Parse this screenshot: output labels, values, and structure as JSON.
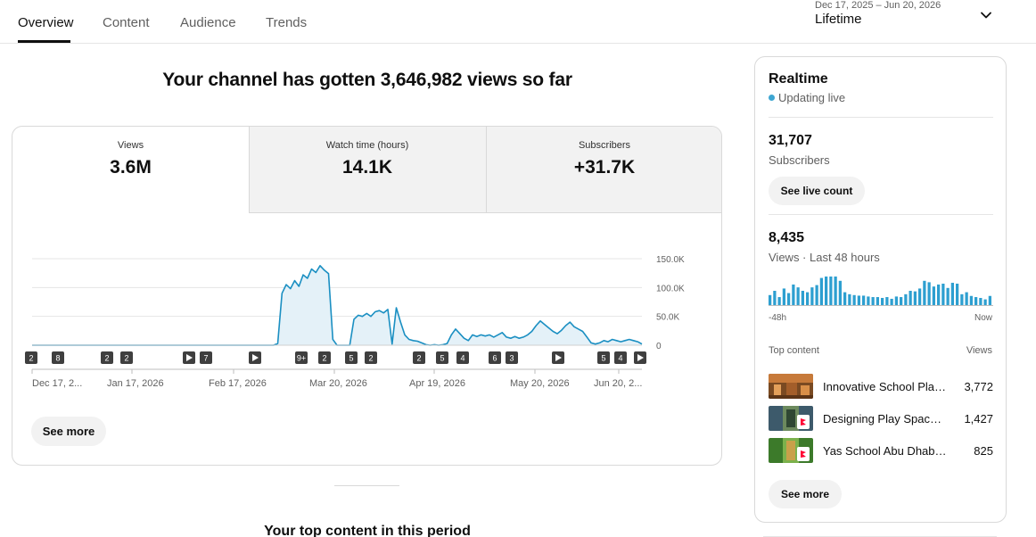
{
  "tabs": [
    {
      "label": "Overview",
      "active": true
    },
    {
      "label": "Content",
      "active": false
    },
    {
      "label": "Audience",
      "active": false
    },
    {
      "label": "Trends",
      "active": false
    }
  ],
  "date_filter": {
    "range": "Dec 17, 2025 – Jun 20, 2026",
    "label": "Lifetime",
    "icon": "chevron-down-icon"
  },
  "headline": "Your channel has gotten 3,646,982 views so far",
  "metrics": [
    {
      "label": "Views",
      "value": "3.6M"
    },
    {
      "label": "Watch time (hours)",
      "value": "14.1K"
    },
    {
      "label": "Subscribers",
      "value": "+31.7K"
    }
  ],
  "chart_data": {
    "type": "area",
    "series": [
      {
        "values": [
          0,
          0,
          0,
          0,
          0,
          0,
          0,
          0,
          0,
          0,
          0,
          0,
          0,
          0,
          0,
          0,
          0,
          0,
          0,
          0,
          0,
          0,
          0,
          0,
          0,
          0,
          0,
          0,
          0,
          0,
          0,
          0,
          0,
          0,
          0,
          0,
          0,
          0,
          0,
          0,
          0,
          0,
          0,
          0,
          0,
          0,
          0,
          0,
          0,
          0,
          0,
          0,
          0,
          0,
          0,
          0,
          0,
          0,
          3000,
          90000,
          105000,
          98000,
          112000,
          102000,
          122000,
          116000,
          132000,
          126000,
          138000,
          130000,
          124000,
          10000,
          0,
          0,
          0,
          0,
          45000,
          52000,
          50000,
          55000,
          50000,
          58000,
          60000,
          56000,
          62000,
          2000,
          65000,
          40000,
          18000,
          10000,
          8000,
          7000,
          4000,
          1000,
          0,
          1000,
          0,
          1000,
          3000,
          18000,
          28000,
          20000,
          12000,
          8000,
          18000,
          15000,
          18000,
          16000,
          18000,
          14000,
          18000,
          22000,
          14000,
          12000,
          15000,
          12000,
          14000,
          18000,
          24000,
          34000,
          42000,
          36000,
          30000,
          24000,
          20000,
          26000,
          34000,
          40000,
          32000,
          28000,
          24000,
          14000,
          4000,
          2000,
          4000,
          8000,
          6000,
          10000,
          8000,
          6000,
          8000,
          10000,
          8000,
          6000,
          2000
        ]
      }
    ],
    "x_tick_labels": [
      "Dec 17, 2...",
      "Jan 17, 2026",
      "Feb 17, 2026",
      "Mar 20, 2026",
      "Apr 19, 2026",
      "May 20, 2026",
      "Jun 20, 2..."
    ],
    "y_tick_labels": [
      "150.0K",
      "100.0K",
      "50.0K",
      "0"
    ],
    "ylim": [
      0,
      150000
    ],
    "grid": true,
    "markers": [
      "2",
      "8",
      "2",
      "2",
      "play",
      "7",
      "play",
      "9+",
      "2",
      "5",
      "2",
      "2",
      "5",
      "4",
      "6",
      "3",
      "play",
      "5",
      "4",
      "play"
    ],
    "colors": {
      "line": "#1a8fc2",
      "fill": "#e4f1f8",
      "grid": "#e5e5e5"
    }
  },
  "main_see_more": "See more",
  "bottom_title": "Your top content in this period",
  "realtime": {
    "title": "Realtime",
    "status": "Updating live",
    "subscribers_count": "31,707",
    "subscribers_label": "Subscribers",
    "see_live_count": "See live count",
    "views_count": "8,435",
    "views_label": "Views · Last 48 hours",
    "bars": [
      0.35,
      0.5,
      0.28,
      0.58,
      0.42,
      0.72,
      0.62,
      0.5,
      0.45,
      0.62,
      0.7,
      0.95,
      1.0,
      1.0,
      1.0,
      0.85,
      0.45,
      0.38,
      0.35,
      0.33,
      0.33,
      0.3,
      0.28,
      0.28,
      0.25,
      0.28,
      0.22,
      0.3,
      0.28,
      0.38,
      0.5,
      0.48,
      0.58,
      0.85,
      0.8,
      0.65,
      0.72,
      0.75,
      0.6,
      0.78,
      0.75,
      0.38,
      0.45,
      0.32,
      0.28,
      0.25,
      0.2,
      0.32
    ],
    "axis_left": "-48h",
    "axis_right": "Now",
    "top_content_label": "Top content",
    "top_content_views_label": "Views",
    "items": [
      {
        "title": "Innovative School Play...",
        "views": "3,772",
        "short": false
      },
      {
        "title": "Designing Play Spaces...",
        "views": "1,427",
        "short": true
      },
      {
        "title": "Yas School Abu Dhabi | ...",
        "views": "825",
        "short": true
      }
    ],
    "see_more": "See more",
    "accent": "#2d9fd0"
  }
}
